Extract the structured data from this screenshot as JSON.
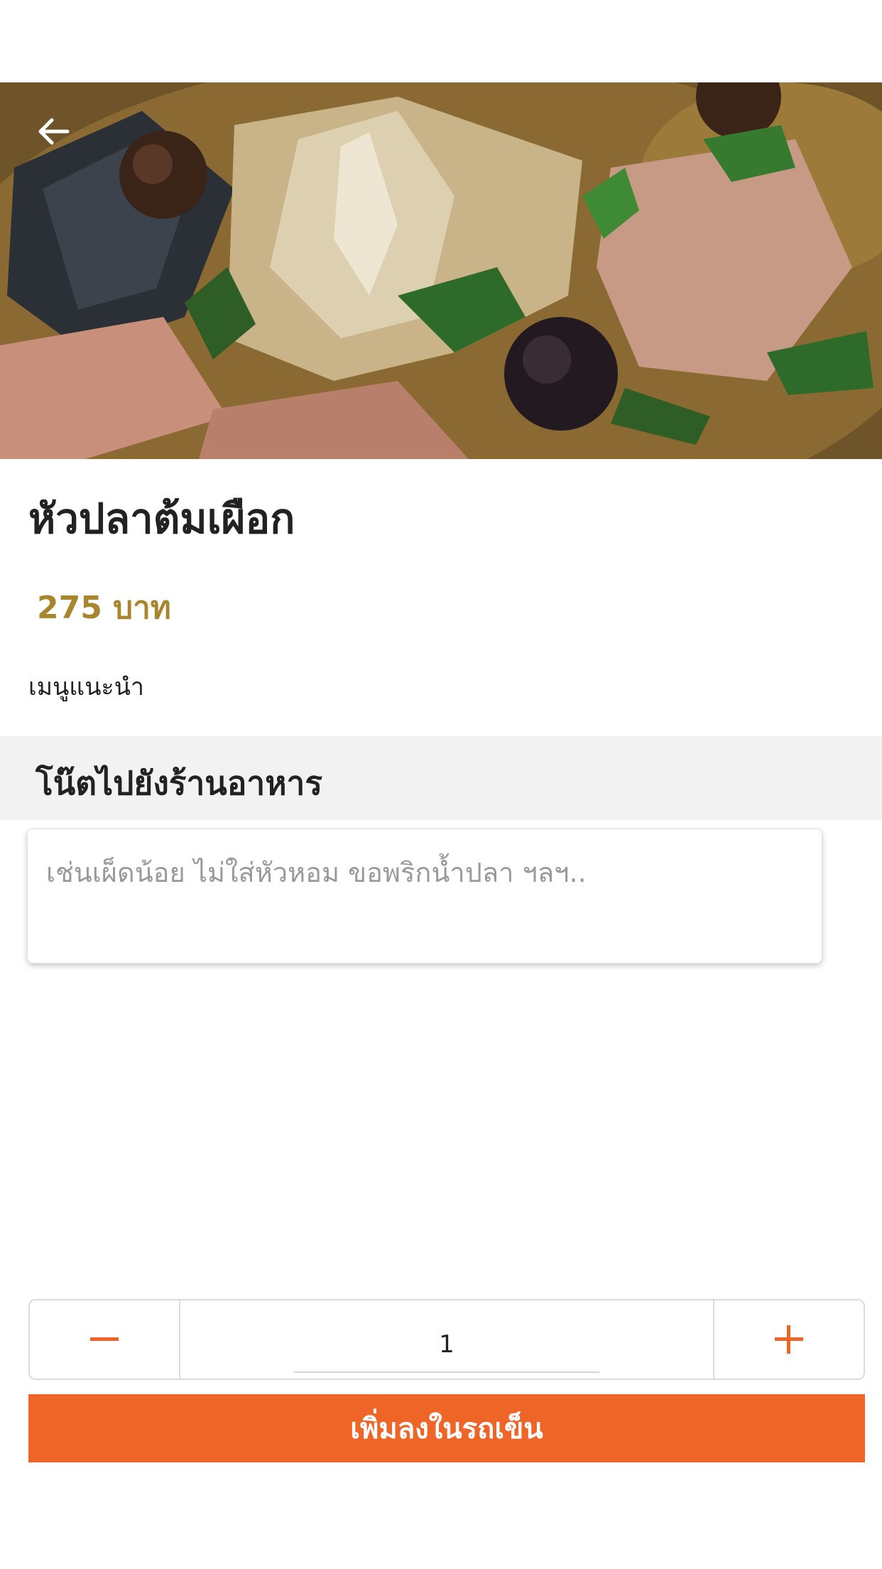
{
  "dish": {
    "name": "หัวปลาต้มเผือก",
    "price": "275 บาท",
    "tag": "เมนูแนะนำ"
  },
  "note": {
    "header": "โน๊ตไปยังร้านอาหาร",
    "placeholder": "เช่นเผ็ดน้อย ไม่ใส่หัวหอม ขอพริกน้ำปลา ฯลฯ.."
  },
  "quantity": {
    "value": "1"
  },
  "actions": {
    "add_to_cart": "เพิ่มลงในรถเข็น"
  },
  "icons": {
    "back": "arrow-left-icon",
    "minus": "minus-icon",
    "plus": "plus-icon"
  },
  "colors": {
    "accent": "#ef6527",
    "price": "#a8862e"
  }
}
